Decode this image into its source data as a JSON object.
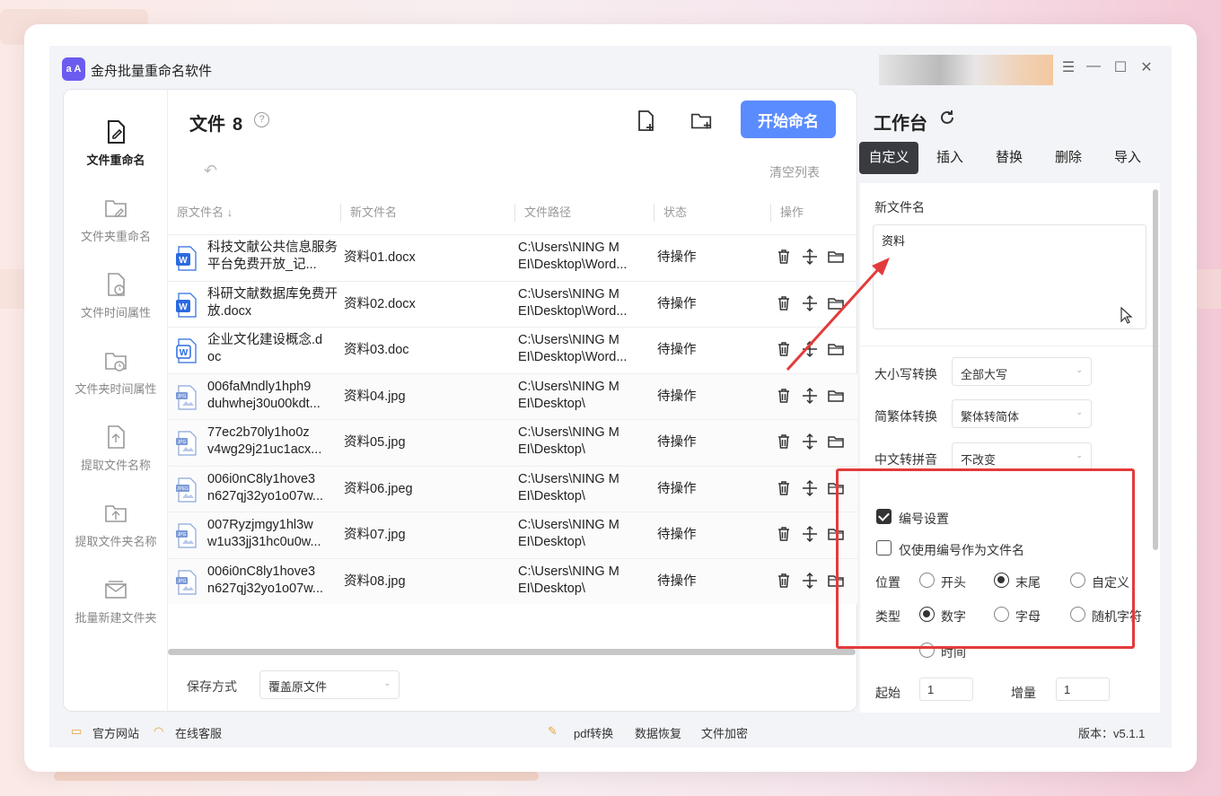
{
  "app": {
    "logo_text": "a A",
    "title": "金舟批量重命名软件"
  },
  "window_controls": {
    "menu": "☰",
    "minimize": "—",
    "maximize": "☐",
    "close": "✕"
  },
  "sidebar": {
    "items": [
      {
        "label": "文件重命名",
        "icon": "file-edit-icon"
      },
      {
        "label": "文件夹重命名",
        "icon": "folder-edit-icon"
      },
      {
        "label": "文件时间属性",
        "icon": "file-clock-icon"
      },
      {
        "label": "文件夹时间属性",
        "icon": "folder-clock-icon"
      },
      {
        "label": "提取文件名称",
        "icon": "file-upload-icon"
      },
      {
        "label": "提取文件夹名称",
        "icon": "folder-upload-icon"
      },
      {
        "label": "批量新建文件夹",
        "icon": "mail-icon"
      }
    ]
  },
  "file_panel": {
    "title": "文件",
    "count": "8",
    "help": "?",
    "start_button": "开始命名",
    "undo": "↶",
    "clear_list": "清空列表",
    "columns": [
      "原文件名 ↓",
      "新文件名",
      "文件路径",
      "状态",
      "操作"
    ],
    "rows": [
      {
        "name": "科技文献公共信息服务平台免费开放_记...",
        "new": "资料01.docx",
        "path": "C:\\Users\\NING M EI\\Desktop\\Word...",
        "status": "待操作",
        "type": "word"
      },
      {
        "name": "科研文献数据库免费开放.docx",
        "new": "资料02.docx",
        "path": "C:\\Users\\NING M EI\\Desktop\\Word...",
        "status": "待操作",
        "type": "word"
      },
      {
        "name": "企业文化建设概念.d oc",
        "new": "资料03.doc",
        "path": "C:\\Users\\NING M EI\\Desktop\\Word...",
        "status": "待操作",
        "type": "word-outline"
      },
      {
        "name": "006faMndly1hph9 duhwhej30u00kdt...",
        "new": "资料04.jpg",
        "path": "C:\\Users\\NING M EI\\Desktop\\",
        "status": "待操作",
        "type": "jpg"
      },
      {
        "name": "77ec2b70ly1ho0z v4wg29j21uc1acx...",
        "new": "资料05.jpg",
        "path": "C:\\Users\\NING M EI\\Desktop\\",
        "status": "待操作",
        "type": "jpg"
      },
      {
        "name": "006i0nC8ly1hove3 n627qj32yo1o07w...",
        "new": "资料06.jpeg",
        "path": "C:\\Users\\NING M EI\\Desktop\\",
        "status": "待操作",
        "type": "jpeg"
      },
      {
        "name": "007Ryzjmgy1hl3w w1u33jj31hc0u0w...",
        "new": "资料07.jpg",
        "path": "C:\\Users\\NING M EI\\Desktop\\",
        "status": "待操作",
        "type": "jpg"
      },
      {
        "name": "006i0nC8ly1hove3 n627qj32yo1o07w...",
        "new": "资料08.jpg",
        "path": "C:\\Users\\NING M EI\\Desktop\\",
        "status": "待操作",
        "type": "jpg"
      }
    ],
    "save_label": "保存方式",
    "save_value": "覆盖原文件"
  },
  "workbench": {
    "title": "工作台",
    "tabs": [
      "自定义",
      "插入",
      "替换",
      "删除",
      "导入"
    ],
    "active_tab": "自定义",
    "new_name_label": "新文件名",
    "new_name_value": "资料",
    "case_label": "大小写转换",
    "case_value": "全部大写",
    "trad_label": "简繁体转换",
    "trad_value": "繁体转简体",
    "pinyin_label": "中文转拼音",
    "pinyin_value": "不改变",
    "numbering_label": "编号设置",
    "numbering_checked": true,
    "only_number_label": "仅使用编号作为文件名",
    "only_number_checked": false,
    "position_label": "位置",
    "position_options": [
      "开头",
      "末尾",
      "自定义"
    ],
    "position_selected": "末尾",
    "type_label": "类型",
    "type_options": [
      "数字",
      "字母",
      "随机字符",
      "时间"
    ],
    "type_selected": "数字",
    "start_label": "起始",
    "start_value": "1",
    "step_label": "增量",
    "step_value": "1"
  },
  "footer": {
    "official_site": "官方网站",
    "online_service": "在线客服",
    "pdf": "pdf转换",
    "recovery": "数据恢复",
    "encrypt": "文件加密",
    "version": "版本：v5.1.1"
  },
  "colors": {
    "accent": "#5b8cff",
    "red_highlight": "#e33b3b",
    "logo": "#6b5cf0",
    "dark_tab": "#3a3b40"
  }
}
